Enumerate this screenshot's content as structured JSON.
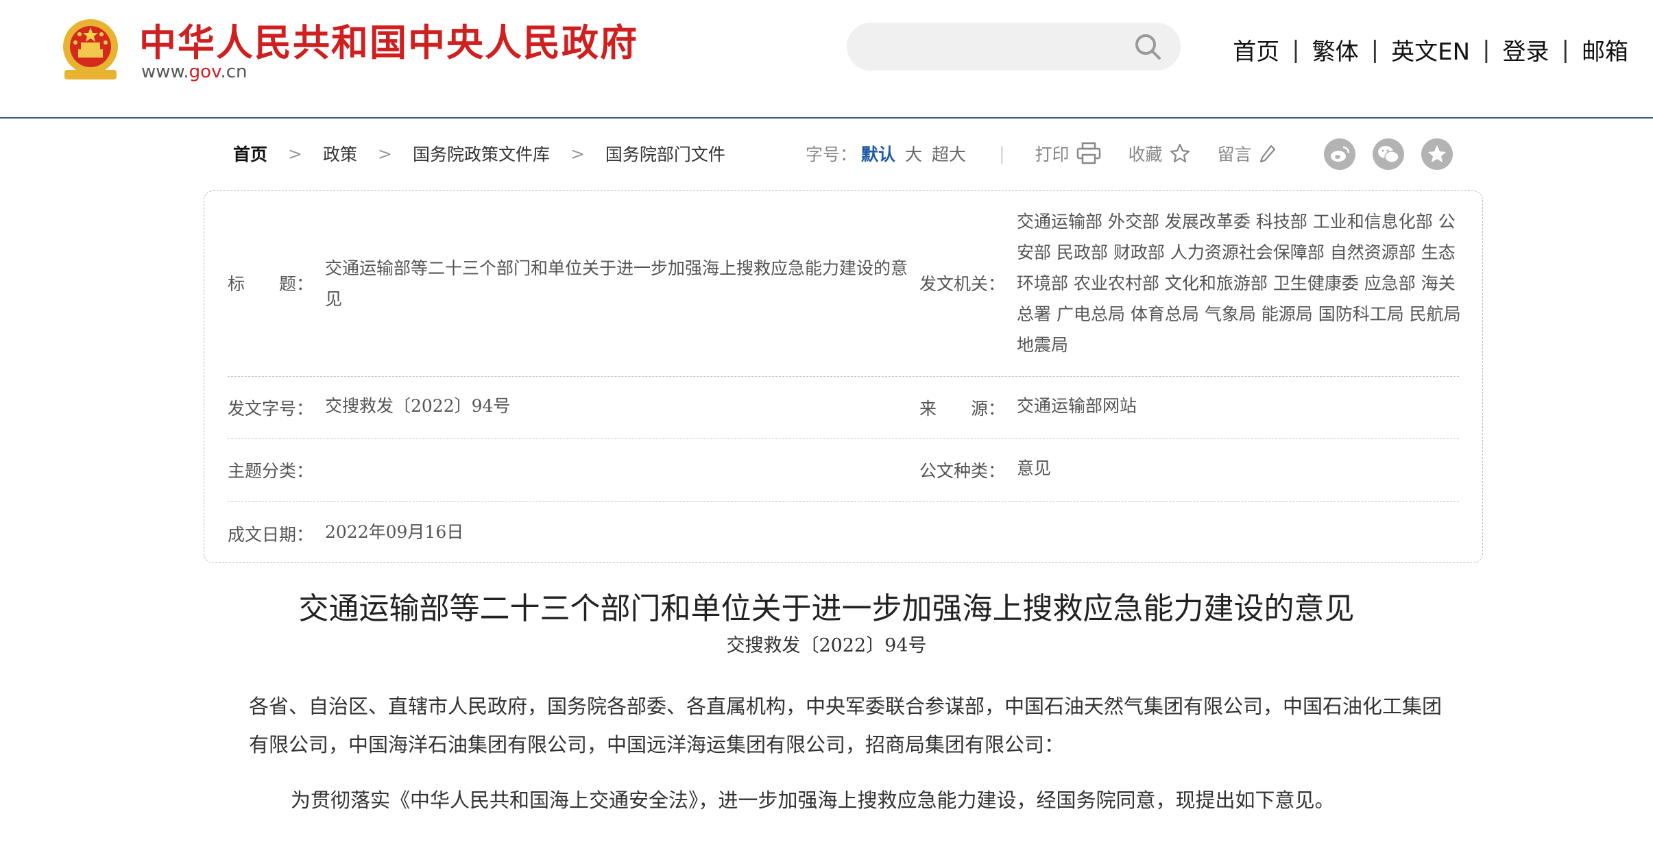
{
  "header": {
    "site_title": "中华人民共和国中央人民政府",
    "domain_prefix": "www.",
    "domain_gov": "gov",
    "domain_suffix": ".cn",
    "search": {
      "value": "",
      "placeholder": ""
    },
    "nav": [
      "首页",
      "繁体",
      "英文EN",
      "登录",
      "邮箱"
    ],
    "nav_separator": "|"
  },
  "breadcrumb": {
    "items": [
      "首页",
      "政策",
      "国务院政策文件库",
      "国务院部门文件"
    ],
    "separator": ">"
  },
  "toolbar": {
    "font_size_label": "字号：",
    "font_sizes": [
      "默认",
      "大",
      "超大"
    ],
    "active_font_size": "默认",
    "divider": "|",
    "print": "打印",
    "favorite": "收藏",
    "comment": "留言",
    "share_icons": [
      "weibo-icon",
      "wechat-icon",
      "qzone-icon"
    ]
  },
  "info": {
    "title_label": "标　　题：",
    "title_value": "交通运输部等二十三个部门和单位关于进一步加强海上搜救应急能力建设的意见",
    "issuer_label": "发文机关：",
    "issuer_value": "交通运输部 外交部 发展改革委 科技部 工业和信息化部 公安部 民政部 财政部 人力资源社会保障部 自然资源部 生态环境部 农业农村部 文化和旅游部 卫生健康委 应急部 海关总署 广电总局 体育总局 气象局 能源局 国防科工局 民航局 地震局",
    "docno_label": "发文字号：",
    "docno_value": "交搜救发〔2022〕94号",
    "source_label": "来　　源：",
    "source_value": "交通运输部网站",
    "topic_label": "主题分类：",
    "topic_value": "",
    "doctype_label": "公文种类：",
    "doctype_value": "意见",
    "date_label": "成文日期：",
    "date_value": "2022年09月16日"
  },
  "article": {
    "title": "交通运输部等二十三个部门和单位关于进一步加强海上搜救应急能力建设的意见",
    "doc_number": "交搜救发〔2022〕94号",
    "paragraph_1": "各省、自治区、直辖市人民政府，国务院各部委、各直属机构，中央军委联合参谋部，中国石油天然气集团有限公司，中国石油化工集团有限公司，中国海洋石油集团有限公司，中国远洋海运集团有限公司，招商局集团有限公司：",
    "paragraph_2": "为贯彻落实《中华人民共和国海上交通安全法》，进一步加强海上搜救应急能力建设，经国务院同意，现提出如下意见。"
  },
  "colors": {
    "brand_red": "#cf1f1f",
    "active_blue": "#1f5aa6",
    "header_rule": "#3b5a86",
    "emblem_gold": "#e8b330"
  }
}
